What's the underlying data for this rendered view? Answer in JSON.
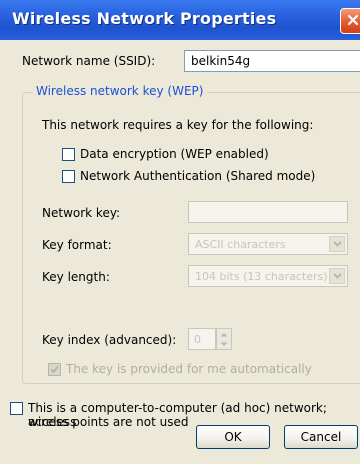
{
  "dialog": {
    "title": "Wireless Network Properties",
    "ssid_label": "Network name (SSID):",
    "ssid_value": "belkin54g",
    "group_title": "Wireless network key (WEP)",
    "requires_text": "This network requires a key for the following:",
    "data_encryption": {
      "label": "Data encryption (WEP enabled)",
      "checked": false
    },
    "network_auth": {
      "label": "Network Authentication (Shared mode)",
      "checked": false
    },
    "network_key_label": "Network key:",
    "network_key_value": "",
    "key_format_label": "Key format:",
    "key_format_value": "ASCII characters",
    "key_length_label": "Key length:",
    "key_length_value": "104 bits (13 characters)",
    "key_index_label": "Key index (advanced):",
    "key_index_value": "0",
    "auto_key_label": "The key is provided for me automatically",
    "adhoc_line1": "This is a computer-to-computer (ad hoc) network; wireless",
    "adhoc_line2": "access points are not used",
    "ok_label": "OK",
    "cancel_label": "Cancel"
  }
}
